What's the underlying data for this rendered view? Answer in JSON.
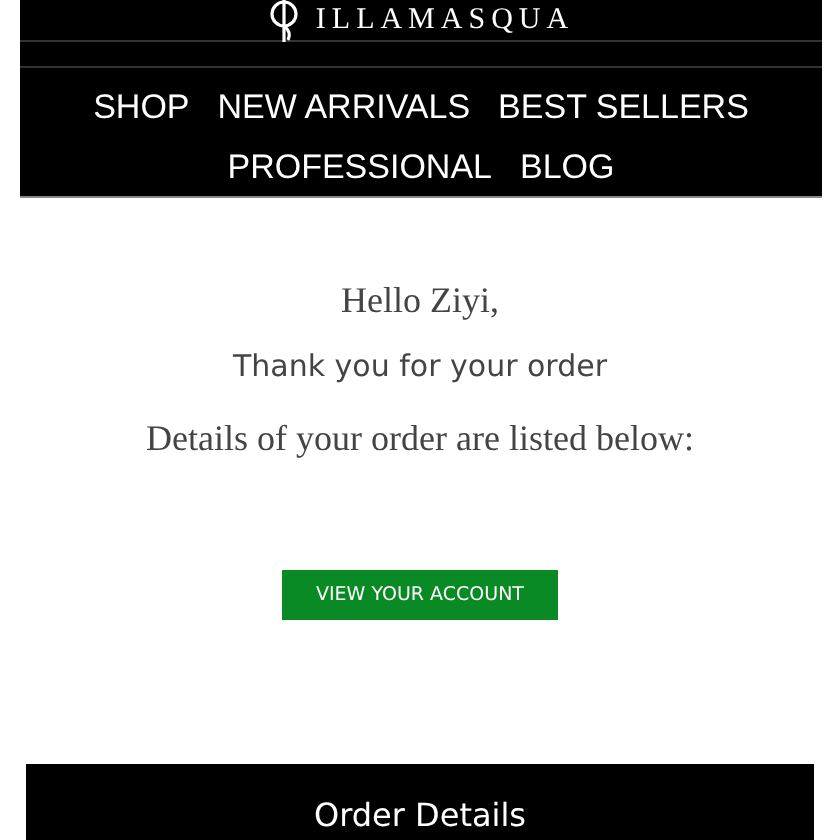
{
  "header": {
    "logo": "ILLAMASQUA",
    "nav": [
      [
        "SHOP",
        "NEW ARRIVALS",
        "BEST SELLERS"
      ],
      [
        "PROFESSIONAL",
        "BLOG"
      ]
    ]
  },
  "greeting": "Hello Ziyi,",
  "thanks": "Thank you for your order",
  "details_note": "Details of your order are listed below:",
  "account_button": "VIEW YOUR ACCOUNT",
  "order_details": {
    "title": "Order Details"
  }
}
